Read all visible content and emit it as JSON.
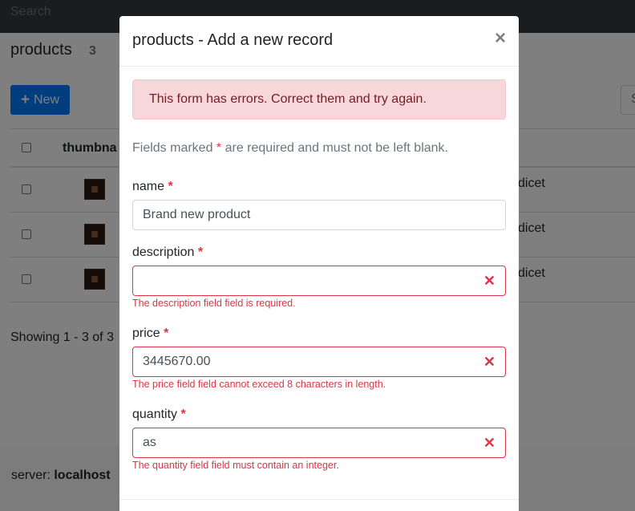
{
  "topbar": {
    "search_placeholder": "Search"
  },
  "page": {
    "title": "products",
    "count": "3",
    "new_label": "New",
    "search_fragment": "S"
  },
  "table": {
    "header_thumbnail": "thumbna",
    "rows": [
      {
        "text": "dicet"
      },
      {
        "text": "dicet"
      },
      {
        "text": "dicet"
      }
    ],
    "showing": "Showing 1 - 3 of 3"
  },
  "footer": {
    "server_label": "server:",
    "server_value": "localhost"
  },
  "modal": {
    "title": "products - Add a new record",
    "close_symbol": "×",
    "alert": "This form has errors. Correct them and try again.",
    "hint_before": "Fields marked ",
    "hint_star": "*",
    "hint_after": " are required and must not be left blank.",
    "fields": [
      {
        "label": "name",
        "value": "Brand new product",
        "error": ""
      },
      {
        "label": "description",
        "value": "",
        "error": "The description field field is required."
      },
      {
        "label": "price",
        "value": "3445670.00",
        "error": "The price field field cannot exceed 8 characters in length."
      },
      {
        "label": "quantity",
        "value": "as",
        "error": "The quantity field field must contain an integer."
      }
    ]
  }
}
